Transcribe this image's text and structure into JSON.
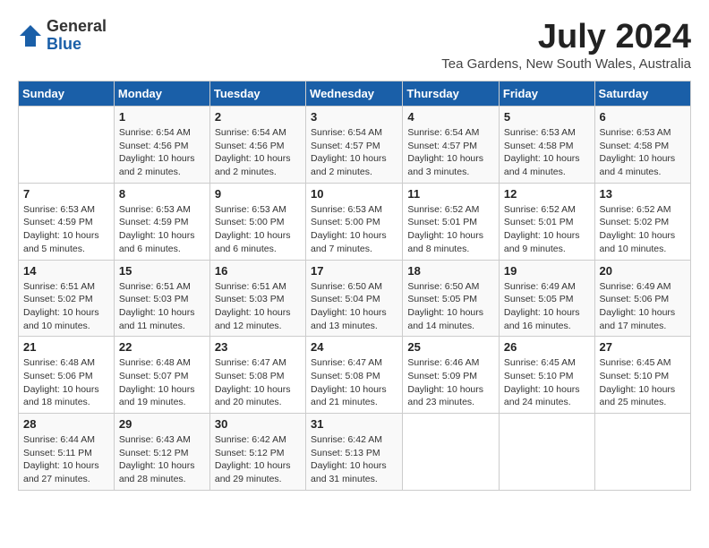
{
  "header": {
    "logo_general": "General",
    "logo_blue": "Blue",
    "month_year": "July 2024",
    "location": "Tea Gardens, New South Wales, Australia"
  },
  "calendar": {
    "days_of_week": [
      "Sunday",
      "Monday",
      "Tuesday",
      "Wednesday",
      "Thursday",
      "Friday",
      "Saturday"
    ],
    "weeks": [
      [
        {
          "day": "",
          "content": ""
        },
        {
          "day": "1",
          "content": "Sunrise: 6:54 AM\nSunset: 4:56 PM\nDaylight: 10 hours\nand 2 minutes."
        },
        {
          "day": "2",
          "content": "Sunrise: 6:54 AM\nSunset: 4:56 PM\nDaylight: 10 hours\nand 2 minutes."
        },
        {
          "day": "3",
          "content": "Sunrise: 6:54 AM\nSunset: 4:57 PM\nDaylight: 10 hours\nand 2 minutes."
        },
        {
          "day": "4",
          "content": "Sunrise: 6:54 AM\nSunset: 4:57 PM\nDaylight: 10 hours\nand 3 minutes."
        },
        {
          "day": "5",
          "content": "Sunrise: 6:53 AM\nSunset: 4:58 PM\nDaylight: 10 hours\nand 4 minutes."
        },
        {
          "day": "6",
          "content": "Sunrise: 6:53 AM\nSunset: 4:58 PM\nDaylight: 10 hours\nand 4 minutes."
        }
      ],
      [
        {
          "day": "7",
          "content": "Sunrise: 6:53 AM\nSunset: 4:59 PM\nDaylight: 10 hours\nand 5 minutes."
        },
        {
          "day": "8",
          "content": "Sunrise: 6:53 AM\nSunset: 4:59 PM\nDaylight: 10 hours\nand 6 minutes."
        },
        {
          "day": "9",
          "content": "Sunrise: 6:53 AM\nSunset: 5:00 PM\nDaylight: 10 hours\nand 6 minutes."
        },
        {
          "day": "10",
          "content": "Sunrise: 6:53 AM\nSunset: 5:00 PM\nDaylight: 10 hours\nand 7 minutes."
        },
        {
          "day": "11",
          "content": "Sunrise: 6:52 AM\nSunset: 5:01 PM\nDaylight: 10 hours\nand 8 minutes."
        },
        {
          "day": "12",
          "content": "Sunrise: 6:52 AM\nSunset: 5:01 PM\nDaylight: 10 hours\nand 9 minutes."
        },
        {
          "day": "13",
          "content": "Sunrise: 6:52 AM\nSunset: 5:02 PM\nDaylight: 10 hours\nand 10 minutes."
        }
      ],
      [
        {
          "day": "14",
          "content": "Sunrise: 6:51 AM\nSunset: 5:02 PM\nDaylight: 10 hours\nand 10 minutes."
        },
        {
          "day": "15",
          "content": "Sunrise: 6:51 AM\nSunset: 5:03 PM\nDaylight: 10 hours\nand 11 minutes."
        },
        {
          "day": "16",
          "content": "Sunrise: 6:51 AM\nSunset: 5:03 PM\nDaylight: 10 hours\nand 12 minutes."
        },
        {
          "day": "17",
          "content": "Sunrise: 6:50 AM\nSunset: 5:04 PM\nDaylight: 10 hours\nand 13 minutes."
        },
        {
          "day": "18",
          "content": "Sunrise: 6:50 AM\nSunset: 5:05 PM\nDaylight: 10 hours\nand 14 minutes."
        },
        {
          "day": "19",
          "content": "Sunrise: 6:49 AM\nSunset: 5:05 PM\nDaylight: 10 hours\nand 16 minutes."
        },
        {
          "day": "20",
          "content": "Sunrise: 6:49 AM\nSunset: 5:06 PM\nDaylight: 10 hours\nand 17 minutes."
        }
      ],
      [
        {
          "day": "21",
          "content": "Sunrise: 6:48 AM\nSunset: 5:06 PM\nDaylight: 10 hours\nand 18 minutes."
        },
        {
          "day": "22",
          "content": "Sunrise: 6:48 AM\nSunset: 5:07 PM\nDaylight: 10 hours\nand 19 minutes."
        },
        {
          "day": "23",
          "content": "Sunrise: 6:47 AM\nSunset: 5:08 PM\nDaylight: 10 hours\nand 20 minutes."
        },
        {
          "day": "24",
          "content": "Sunrise: 6:47 AM\nSunset: 5:08 PM\nDaylight: 10 hours\nand 21 minutes."
        },
        {
          "day": "25",
          "content": "Sunrise: 6:46 AM\nSunset: 5:09 PM\nDaylight: 10 hours\nand 23 minutes."
        },
        {
          "day": "26",
          "content": "Sunrise: 6:45 AM\nSunset: 5:10 PM\nDaylight: 10 hours\nand 24 minutes."
        },
        {
          "day": "27",
          "content": "Sunrise: 6:45 AM\nSunset: 5:10 PM\nDaylight: 10 hours\nand 25 minutes."
        }
      ],
      [
        {
          "day": "28",
          "content": "Sunrise: 6:44 AM\nSunset: 5:11 PM\nDaylight: 10 hours\nand 27 minutes."
        },
        {
          "day": "29",
          "content": "Sunrise: 6:43 AM\nSunset: 5:12 PM\nDaylight: 10 hours\nand 28 minutes."
        },
        {
          "day": "30",
          "content": "Sunrise: 6:42 AM\nSunset: 5:12 PM\nDaylight: 10 hours\nand 29 minutes."
        },
        {
          "day": "31",
          "content": "Sunrise: 6:42 AM\nSunset: 5:13 PM\nDaylight: 10 hours\nand 31 minutes."
        },
        {
          "day": "",
          "content": ""
        },
        {
          "day": "",
          "content": ""
        },
        {
          "day": "",
          "content": ""
        }
      ]
    ]
  }
}
